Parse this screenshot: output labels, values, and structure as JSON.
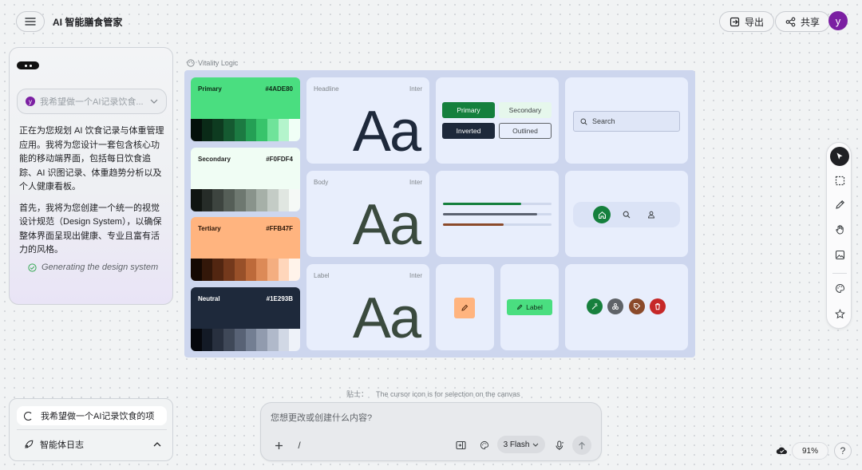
{
  "header": {
    "app_title": "AI 智能膳食管家",
    "export_label": "导出",
    "share_label": "共享",
    "avatar_initial": "y"
  },
  "chat": {
    "prompt_preview": "我希望做一个AI记录饮食...",
    "paragraphs": [
      "正在为您规划 AI 饮食记录与体重管理应用。我将为您设计一套包含核心功能的移动端界面，包括每日饮食追踪、AI 识图记录、体重趋势分析以及个人健康看板。",
      "首先，我将为您创建一个统一的视觉设计规范（Design System），以确保整体界面呈现出健康、专业且富有活力的风格。"
    ],
    "status": "Generating the design system"
  },
  "canvas": {
    "label": "Vitality Logic",
    "swatches": [
      {
        "name": "Primary",
        "hex": "#4ADE80",
        "text_color": "#0f2a17",
        "ramp": [
          "#04100a",
          "#0a2a17",
          "#0e3b20",
          "#155a31",
          "#1c7a42",
          "#24a055",
          "#37c46b",
          "#6fe39a",
          "#b4f4cc",
          "#f0fff6"
        ]
      },
      {
        "name": "Secondary",
        "hex": "#F0FDF4",
        "text_color": "#1f1f1f",
        "ramp": [
          "#101511",
          "#262c28",
          "#3d443f",
          "#555e57",
          "#6e7870",
          "#89938b",
          "#a6b0a8",
          "#c4ccc6",
          "#e0e6e1",
          "#f5f9f6"
        ]
      },
      {
        "name": "Tertiary",
        "hex": "#FFB47F",
        "text_color": "#2a1608",
        "ramp": [
          "#140802",
          "#331709",
          "#522611",
          "#74391c",
          "#985029",
          "#bd6a3a",
          "#dc8a57",
          "#f4ae80",
          "#ffd6bb",
          "#fff3ea"
        ]
      },
      {
        "name": "Neutral",
        "hex": "#1E293B",
        "text_color": "#ffffff",
        "ramp": [
          "#05070c",
          "#131a26",
          "#28303f",
          "#3f4858",
          "#586275",
          "#737e92",
          "#919bae",
          "#b0b9ca",
          "#d1d8e5",
          "#eef2f9"
        ]
      }
    ],
    "typography": [
      {
        "role": "Headline",
        "font": "Inter",
        "sample": "Aa",
        "color": "#1e293b"
      },
      {
        "role": "Body",
        "font": "Inter",
        "sample": "Aa",
        "color": "#3a4a3e"
      },
      {
        "role": "Label",
        "font": "Inter",
        "sample": "Aa",
        "color": "#3a4a3e"
      }
    ],
    "buttons": {
      "primary": "Primary",
      "secondary": "Secondary",
      "inverted": "Inverted",
      "outlined": "Outlined"
    },
    "search_placeholder": "Search",
    "chip_label": "Label",
    "colors": {
      "primary_dark": "#17803d",
      "brown": "#8b4a2a",
      "danger": "#c62828",
      "neutral_grey": "#5f6368",
      "progress_grey": "#5b6270"
    },
    "progress": {
      "primary": 0.72,
      "neutral": 0.87,
      "tertiary": 0.56
    }
  },
  "tip": {
    "prefix": "贴士：",
    "text": "The cursor icon is for selection on the canvas"
  },
  "agent": {
    "task": "我希望做一个AI记录饮食的项",
    "log_label": "智能体日志"
  },
  "composer": {
    "placeholder": "您想更改或创建什么内容?",
    "slash": "/",
    "model": "3 Flash"
  },
  "footer": {
    "zoom": "91%",
    "help": "?"
  },
  "toolbar_icons": [
    "cursor-icon",
    "marquee-select-icon",
    "pencil-icon",
    "hand-icon",
    "image-icon",
    "palette-icon",
    "star-icon"
  ]
}
